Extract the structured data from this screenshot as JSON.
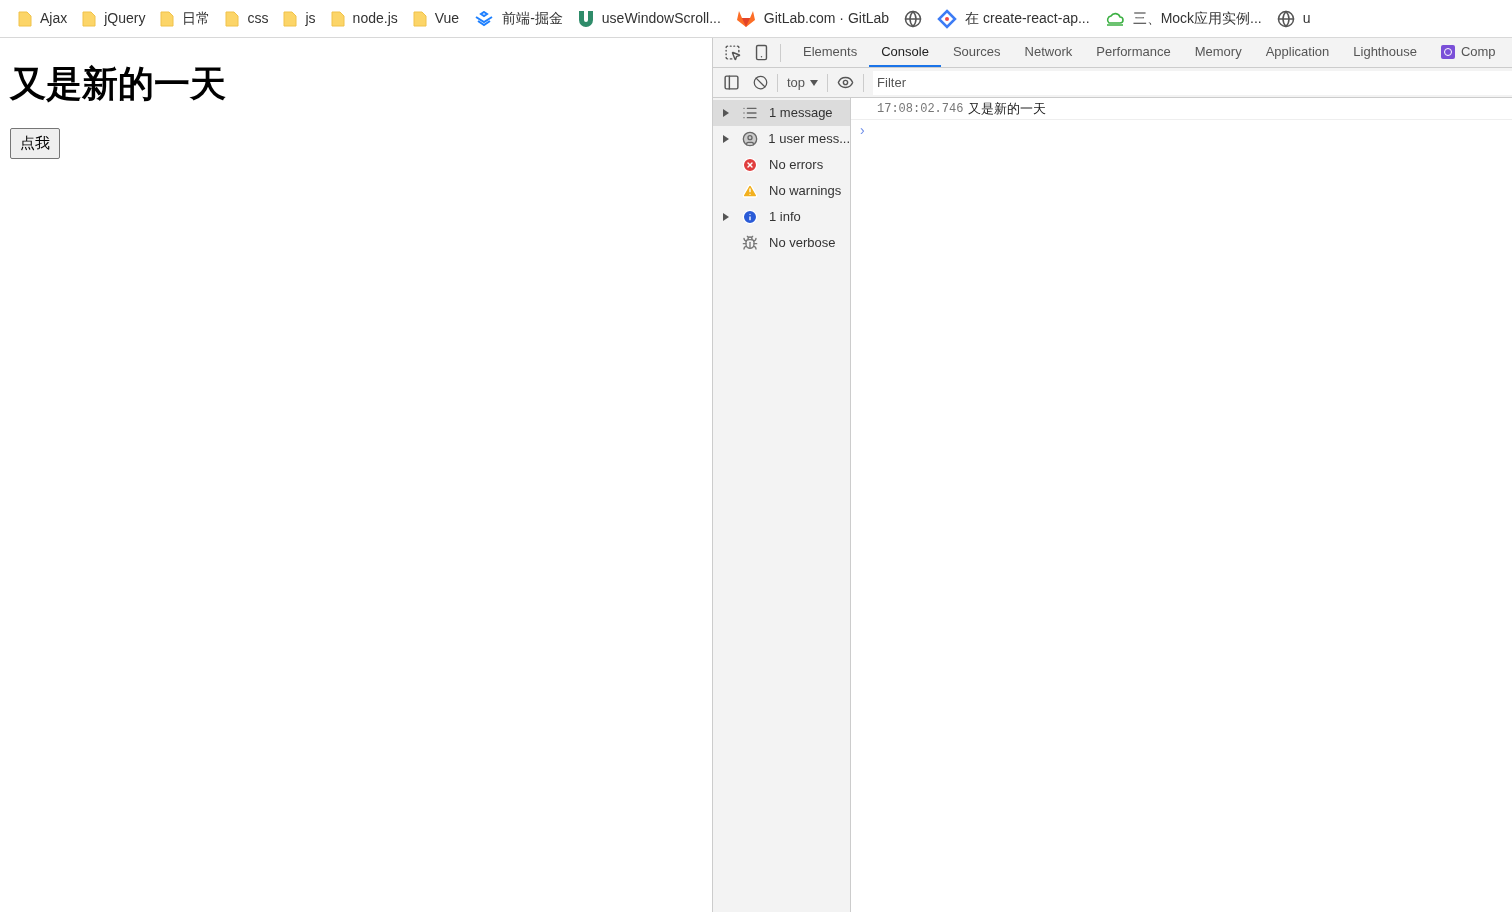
{
  "bookmarks": [
    {
      "label": "Ajax",
      "kind": "folder"
    },
    {
      "label": "jQuery",
      "kind": "folder"
    },
    {
      "label": "日常",
      "kind": "folder"
    },
    {
      "label": "css",
      "kind": "folder"
    },
    {
      "label": "js",
      "kind": "folder"
    },
    {
      "label": "node.js",
      "kind": "folder"
    },
    {
      "label": "Vue",
      "kind": "folder"
    },
    {
      "label": "前端-掘金",
      "kind": "chevrons"
    },
    {
      "label": "useWindowScroll...",
      "kind": "u"
    },
    {
      "label": "GitLab.com · GitLab",
      "kind": "fox"
    },
    {
      "kind": "globe"
    },
    {
      "label": "在 create-react-ap...",
      "kind": "diamond"
    },
    {
      "label": "三、Mock应用实例...",
      "kind": "cloud"
    },
    {
      "label": "u",
      "kind": "globe"
    }
  ],
  "page": {
    "heading": "又是新的一天",
    "button": "点我"
  },
  "devtools": {
    "tabs": [
      {
        "label": "Elements",
        "selected": false
      },
      {
        "label": "Console",
        "selected": true
      },
      {
        "label": "Sources",
        "selected": false
      },
      {
        "label": "Network",
        "selected": false
      },
      {
        "label": "Performance",
        "selected": false
      },
      {
        "label": "Memory",
        "selected": false
      },
      {
        "label": "Application",
        "selected": false
      },
      {
        "label": "Lighthouse",
        "selected": false
      },
      {
        "label": "Comp",
        "selected": false,
        "kind": "react"
      }
    ],
    "context": "top",
    "filter_placeholder": "Filter",
    "sidebar": [
      {
        "label": "1 message",
        "kind": "list",
        "expandable": true,
        "selected": true
      },
      {
        "label": "1 user mess...",
        "kind": "user",
        "expandable": true,
        "selected": false
      },
      {
        "label": "No errors",
        "kind": "error",
        "expandable": false,
        "selected": false
      },
      {
        "label": "No warnings",
        "kind": "warning",
        "expandable": false,
        "selected": false
      },
      {
        "label": "1 info",
        "kind": "info",
        "expandable": true,
        "selected": false
      },
      {
        "label": "No verbose",
        "kind": "verbose",
        "expandable": false,
        "selected": false
      }
    ],
    "messages": [
      {
        "time": "17:08:02.746",
        "text": "又是新的一天"
      }
    ],
    "prompt": "›"
  }
}
